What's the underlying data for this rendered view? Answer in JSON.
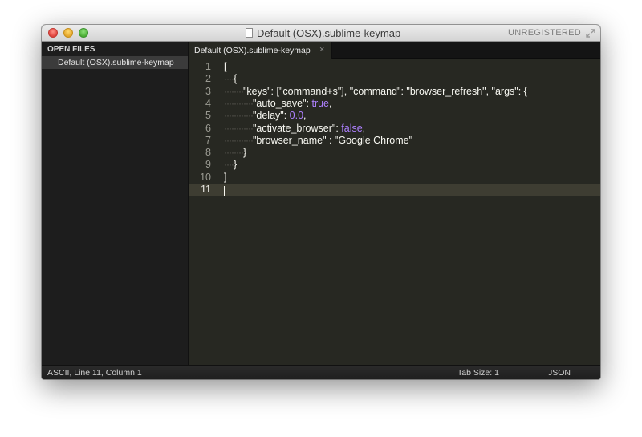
{
  "window": {
    "title": "Default (OSX).sublime-keymap",
    "license_status": "UNREGISTERED"
  },
  "sidebar": {
    "header": "OPEN FILES",
    "files": [
      {
        "label": "Default (OSX).sublime-keymap"
      }
    ]
  },
  "tabs": [
    {
      "label": "Default (OSX).sublime-keymap",
      "close_glyph": "×"
    }
  ],
  "editor": {
    "line_numbers": [
      "1",
      "2",
      "3",
      "4",
      "5",
      "6",
      "7",
      "8",
      "9",
      "10",
      "11"
    ],
    "current_line": "11",
    "lines": [
      {
        "guide": "",
        "parts": [
          {
            "text": "[",
            "cls": ""
          }
        ]
      },
      {
        "guide": "····",
        "parts": [
          {
            "text": "{",
            "cls": ""
          }
        ]
      },
      {
        "guide": "········",
        "parts": [
          {
            "text": "\"keys\": [\"command+s\"], \"command\": \"browser_refresh\", \"args\": {",
            "cls": ""
          }
        ]
      },
      {
        "guide": "············",
        "parts": [
          {
            "text": "\"auto_save\": ",
            "cls": ""
          },
          {
            "text": "true",
            "cls": "kw"
          },
          {
            "text": ",",
            "cls": ""
          }
        ]
      },
      {
        "guide": "············",
        "parts": [
          {
            "text": "\"delay\": ",
            "cls": ""
          },
          {
            "text": "0.0",
            "cls": "num"
          },
          {
            "text": ",",
            "cls": ""
          }
        ]
      },
      {
        "guide": "············",
        "parts": [
          {
            "text": "\"activate_browser\": ",
            "cls": ""
          },
          {
            "text": "false",
            "cls": "kw"
          },
          {
            "text": ",",
            "cls": ""
          }
        ]
      },
      {
        "guide": "············",
        "parts": [
          {
            "text": "\"browser_name\" : \"Google Chrome\"",
            "cls": ""
          }
        ]
      },
      {
        "guide": "········",
        "parts": [
          {
            "text": "}",
            "cls": ""
          }
        ]
      },
      {
        "guide": "····",
        "parts": [
          {
            "text": "}",
            "cls": ""
          }
        ]
      },
      {
        "guide": "",
        "parts": [
          {
            "text": "]",
            "cls": ""
          }
        ]
      },
      {
        "guide": "",
        "parts": [
          {
            "text": "",
            "cls": ""
          }
        ]
      }
    ]
  },
  "statusbar": {
    "position": "ASCII, Line 11, Column 1",
    "tab_size": "Tab Size: 1",
    "syntax": "JSON"
  },
  "colors": {
    "background": "#272822",
    "sidebar": "#1d1d1d",
    "constant": "#ae81ff",
    "current_line": "#3e3d32"
  },
  "icons": [
    "close-window-icon",
    "minimize-window-icon",
    "zoom-window-icon",
    "document-icon",
    "fullscreen-icon",
    "close-tab-icon"
  ]
}
